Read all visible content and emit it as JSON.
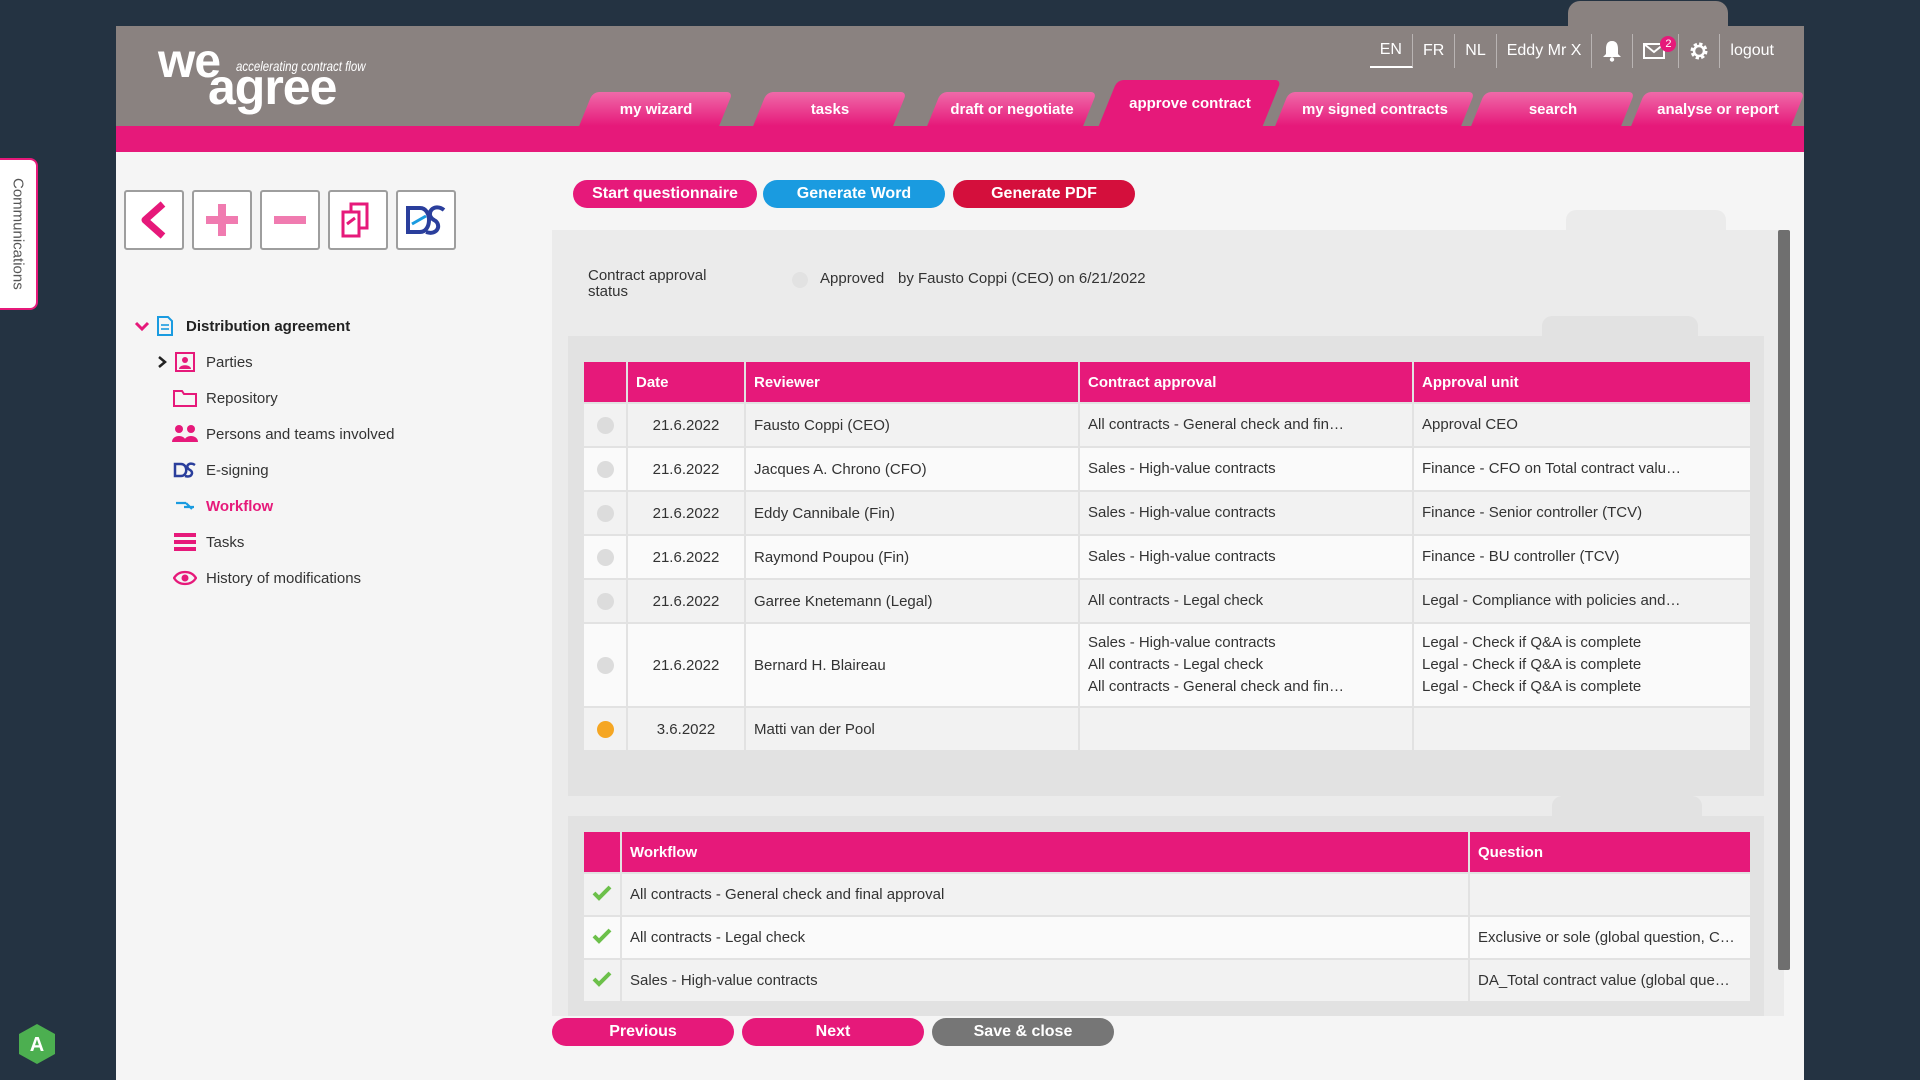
{
  "side_tab": {
    "label": "Communications"
  },
  "status_badge": {
    "letter": "A"
  },
  "logo": {
    "we": "we",
    "agree": "agree",
    "tagline": "accelerating contract flow"
  },
  "topbar": {
    "languages": [
      "EN",
      "FR",
      "NL"
    ],
    "active_language": "EN",
    "user": "Eddy Mr X",
    "message_count": "2",
    "logout": "logout"
  },
  "nav": {
    "tabs": [
      {
        "label": "my wizard"
      },
      {
        "label": "tasks"
      },
      {
        "label": "draft or negotiate"
      },
      {
        "label": "approve contract"
      },
      {
        "label": "my signed contracts"
      },
      {
        "label": "search"
      },
      {
        "label": "analyse or report"
      }
    ],
    "active": "approve contract"
  },
  "tree": {
    "root": "Distribution agreement",
    "items": [
      {
        "label": "Parties"
      },
      {
        "label": "Repository"
      },
      {
        "label": "Persons and teams involved"
      },
      {
        "label": "E-signing"
      },
      {
        "label": "Workflow"
      },
      {
        "label": "Tasks"
      },
      {
        "label": "History of modifications"
      }
    ],
    "active": "Workflow"
  },
  "actions": {
    "start_questionnaire": "Start questionnaire",
    "generate_word": "Generate Word",
    "generate_pdf": "Generate PDF"
  },
  "approval_status": {
    "label": "Contract approval status",
    "value": "Approved",
    "by": "by Fausto Coppi (CEO) on 6/21/2022"
  },
  "reviewers": {
    "headers": {
      "date": "Date",
      "reviewer": "Reviewer",
      "approval": "Contract approval",
      "unit": "Approval unit"
    },
    "rows": [
      {
        "date": "21.6.2022",
        "reviewer": "Fausto Coppi (CEO)",
        "approval": [
          "All contracts - General check and fin…"
        ],
        "unit": [
          "Approval CEO"
        ],
        "status": "done"
      },
      {
        "date": "21.6.2022",
        "reviewer": "Jacques A. Chrono (CFO)",
        "approval": [
          "Sales - High-value contracts"
        ],
        "unit": [
          "Finance - CFO on Total contract valu…"
        ],
        "status": "done"
      },
      {
        "date": "21.6.2022",
        "reviewer": "Eddy Cannibale (Fin)",
        "approval": [
          "Sales - High-value contracts"
        ],
        "unit": [
          "Finance - Senior controller (TCV)"
        ],
        "status": "done"
      },
      {
        "date": "21.6.2022",
        "reviewer": "Raymond Poupou (Fin)",
        "approval": [
          "Sales - High-value contracts"
        ],
        "unit": [
          "Finance - BU controller (TCV)"
        ],
        "status": "done"
      },
      {
        "date": "21.6.2022",
        "reviewer": "Garree Knetemann (Legal)",
        "approval": [
          "All contracts - Legal check"
        ],
        "unit": [
          "Legal - Compliance with policies and…"
        ],
        "status": "done"
      },
      {
        "date": "21.6.2022",
        "reviewer": "Bernard H. Blaireau",
        "approval": [
          "Sales - High-value contracts",
          "All contracts - Legal check",
          "All contracts - General check and fin…"
        ],
        "unit": [
          "Legal - Check if Q&A is complete",
          "Legal - Check if Q&A is complete",
          "Legal - Check if Q&A is complete"
        ],
        "status": "done"
      },
      {
        "date": "3.6.2022",
        "reviewer": "Matti van der Pool",
        "approval": [],
        "unit": [],
        "status": "pending"
      }
    ]
  },
  "workflows": {
    "headers": {
      "workflow": "Workflow",
      "question": "Question"
    },
    "rows": [
      {
        "workflow": "All contracts - General check and final approval",
        "question": ""
      },
      {
        "workflow": "All contracts - Legal check",
        "question": "Exclusive or sole (global question, C…"
      },
      {
        "workflow": "Sales - High-value contracts",
        "question": "DA_Total contract value (global que…"
      }
    ]
  },
  "footer": {
    "previous": "Previous",
    "next": "Next",
    "save_close": "Save & close"
  },
  "colors": {
    "brand_pink": "#e6197a",
    "header_gray": "#8a8280",
    "word_blue": "#1a9be0",
    "pdf_red": "#d40f3c",
    "save_gray": "#767676",
    "check_green": "#6cc04a",
    "pending_orange": "#f5a623"
  }
}
